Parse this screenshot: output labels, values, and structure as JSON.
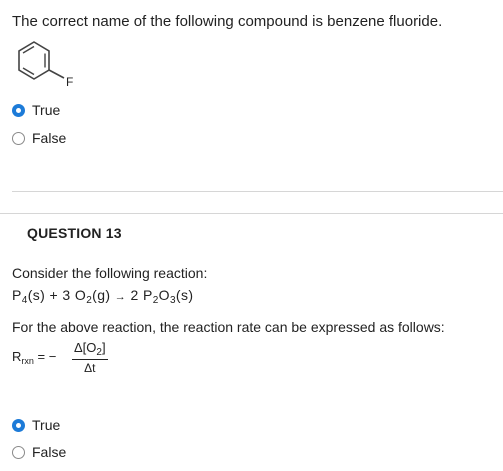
{
  "question_prev": {
    "prompt": "The correct name of the following compound is benzene fluoride.",
    "structure_label": "F",
    "options": [
      {
        "label": "True",
        "selected": true
      },
      {
        "label": "False",
        "selected": false
      }
    ]
  },
  "question13": {
    "heading": "QUESTION 13",
    "intro": "Consider the following reaction:",
    "reaction": {
      "r1": "P",
      "r1_sub": "4",
      "r1_state": "(s)",
      "plus": "+ 3 O",
      "r2_sub": "2",
      "r2_state": "(g)",
      "arrow": "→",
      "p_coef": "2 P",
      "p_sub1": "2",
      "p_o": "O",
      "p_sub2": "3",
      "p_state": "(s)"
    },
    "statement": "For the above reaction, the reaction rate can be expressed as follows:",
    "rate": {
      "R": "R",
      "R_sub": "rxn",
      "eq": "= −",
      "num_pre": "Δ[O",
      "num_sub": "2",
      "num_post": "]",
      "den": "Δt"
    },
    "options": [
      {
        "label": "True",
        "selected": true
      },
      {
        "label": "False",
        "selected": false
      }
    ]
  },
  "colors": {
    "radio_selected": "#1d7bd8",
    "divider": "#d6d6d6"
  }
}
